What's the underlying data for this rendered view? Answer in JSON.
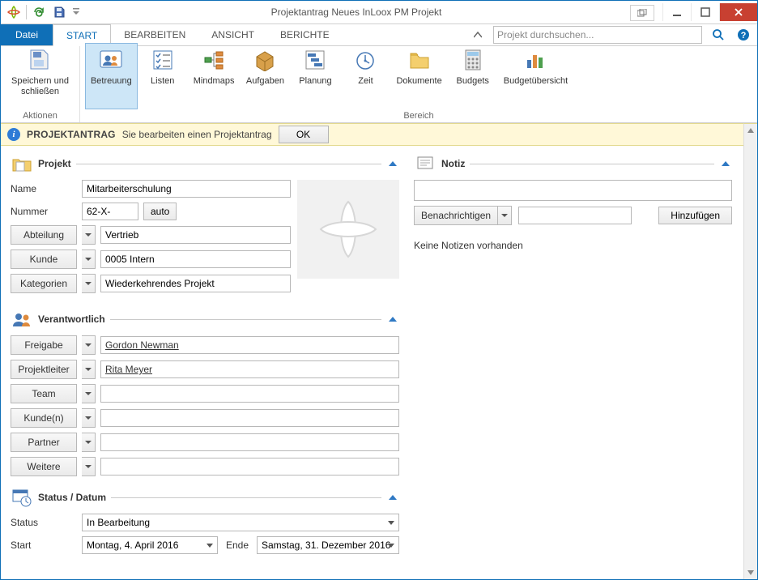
{
  "window": {
    "title": "Projektantrag Neues InLoox PM Projekt"
  },
  "tabs": {
    "file": "Datei",
    "start": "START",
    "edit": "BEARBEITEN",
    "view": "ANSICHT",
    "reports": "BERICHTE"
  },
  "search": {
    "placeholder": "Projekt durchsuchen..."
  },
  "ribbon": {
    "group_actions_label": "Aktionen",
    "group_bereich_label": "Bereich",
    "items": {
      "save_close": "Speichern und\nschließen",
      "betreuung": "Betreuung",
      "listen": "Listen",
      "mindmaps": "Mindmaps",
      "aufgaben": "Aufgaben",
      "planung": "Planung",
      "zeit": "Zeit",
      "dokumente": "Dokumente",
      "budgets": "Budgets",
      "budgetuebersicht": "Budgetübersicht"
    }
  },
  "notice": {
    "title": "PROJEKTANTRAG",
    "message": "Sie bearbeiten einen Projektantrag",
    "ok": "OK"
  },
  "projekt": {
    "header": "Projekt",
    "name_label": "Name",
    "name": "Mitarbeiterschulung",
    "nummer_label": "Nummer",
    "nummer": "62-X-",
    "auto": "auto",
    "abteilung_btn": "Abteilung",
    "abteilung": "Vertrieb",
    "kunde_btn": "Kunde",
    "kunde": "0005 Intern",
    "kategorien_btn": "Kategorien",
    "kategorien": "Wiederkehrendes Projekt"
  },
  "verantwortlich": {
    "header": "Verantwortlich",
    "freigabe_btn": "Freigabe",
    "freigabe": "Gordon Newman",
    "projektleiter_btn": "Projektleiter",
    "projektleiter": "Rita Meyer",
    "team_btn": "Team",
    "team": "",
    "kunden_btn": "Kunde(n)",
    "kunden": "",
    "partner_btn": "Partner",
    "partner": "",
    "weitere_btn": "Weitere",
    "weitere": ""
  },
  "status": {
    "header": "Status / Datum",
    "status_label": "Status",
    "status": "In Bearbeitung",
    "start_label": "Start",
    "start": "Montag, 4. April 2016",
    "ende_label": "Ende",
    "ende": "Samstag, 31. Dezember 2016"
  },
  "notiz": {
    "header": "Notiz",
    "benachrichtigen": "Benachrichtigen",
    "hinzufuegen": "Hinzufügen",
    "empty": "Keine Notizen vorhanden"
  }
}
